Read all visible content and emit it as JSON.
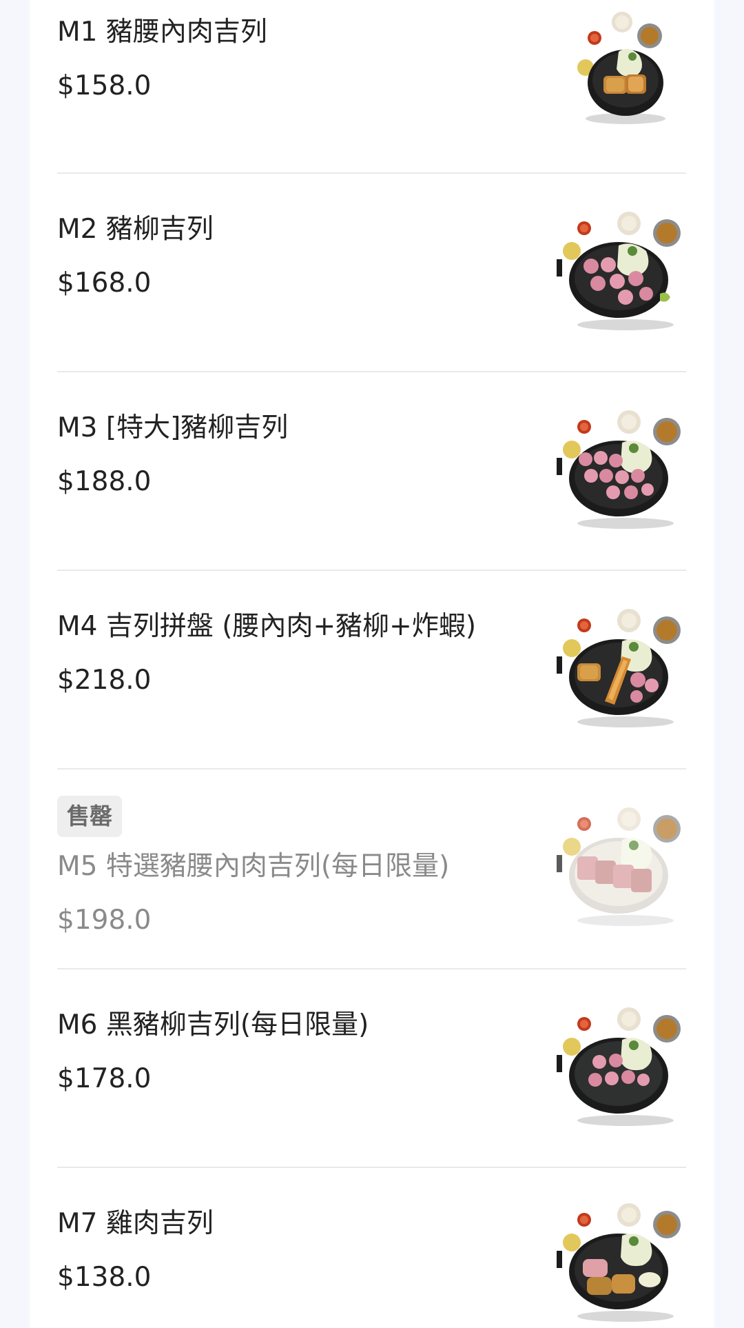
{
  "menu": {
    "items": [
      {
        "name": "M1 豬腰內肉吉列",
        "price": "$158.0",
        "sold_out": false,
        "meat": "katsu"
      },
      {
        "name": "M2 豬柳吉列",
        "price": "$168.0",
        "sold_out": false,
        "meat": "pink"
      },
      {
        "name": "M3 [特大]豬柳吉列",
        "price": "$188.0",
        "sold_out": false,
        "meat": "pink"
      },
      {
        "name": "M4 吉列拼盤 (腰內肉+豬柳+炸蝦)",
        "price": "$218.0",
        "sold_out": false,
        "meat": "combo"
      },
      {
        "name": "M5 特選豬腰內肉吉列(每日限量)",
        "price": "$198.0",
        "sold_out": true,
        "badge": "售罄",
        "meat": "platter"
      },
      {
        "name": "M6 黑豬柳吉列(每日限量)",
        "price": "$178.0",
        "sold_out": false,
        "meat": "pink"
      },
      {
        "name": "M7 雞肉吉列",
        "price": "$138.0",
        "sold_out": false,
        "meat": "chicken"
      }
    ]
  },
  "colors": {
    "page_background": "#f5f7fc",
    "panel_background": "#ffffff",
    "text": "#222222",
    "sold_out_text": "#8a8a8a",
    "badge_background": "#eeeeee",
    "divider": "#e9e9e9"
  }
}
